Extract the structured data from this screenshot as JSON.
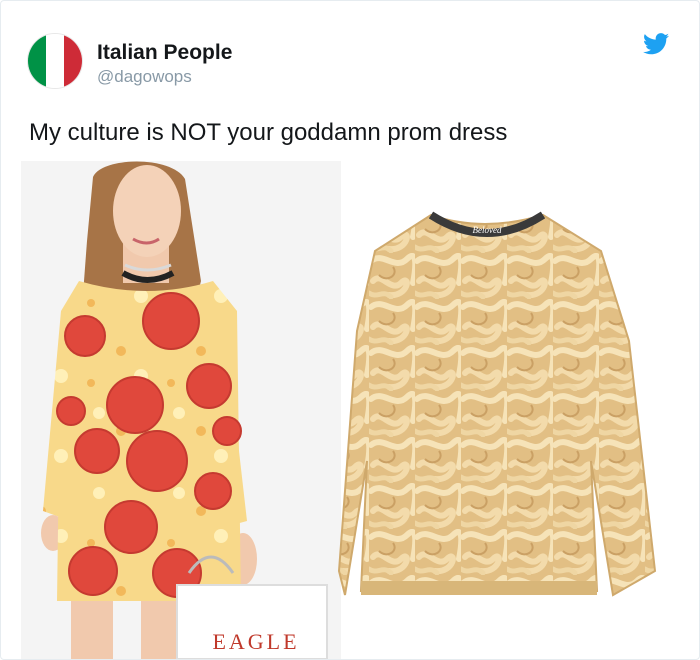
{
  "tweet": {
    "display_name": "Italian People",
    "handle": "@dagowops",
    "text": "My culture is NOT your goddamn prom dress",
    "avatar_colors": [
      "#009246",
      "#ffffff",
      "#ce2b37"
    ],
    "logo_icon": "twitter-bird-icon",
    "logo_color": "#1da1f2"
  },
  "media": {
    "bag_text": "EAGLE",
    "sweater_tag": "Beloved"
  }
}
